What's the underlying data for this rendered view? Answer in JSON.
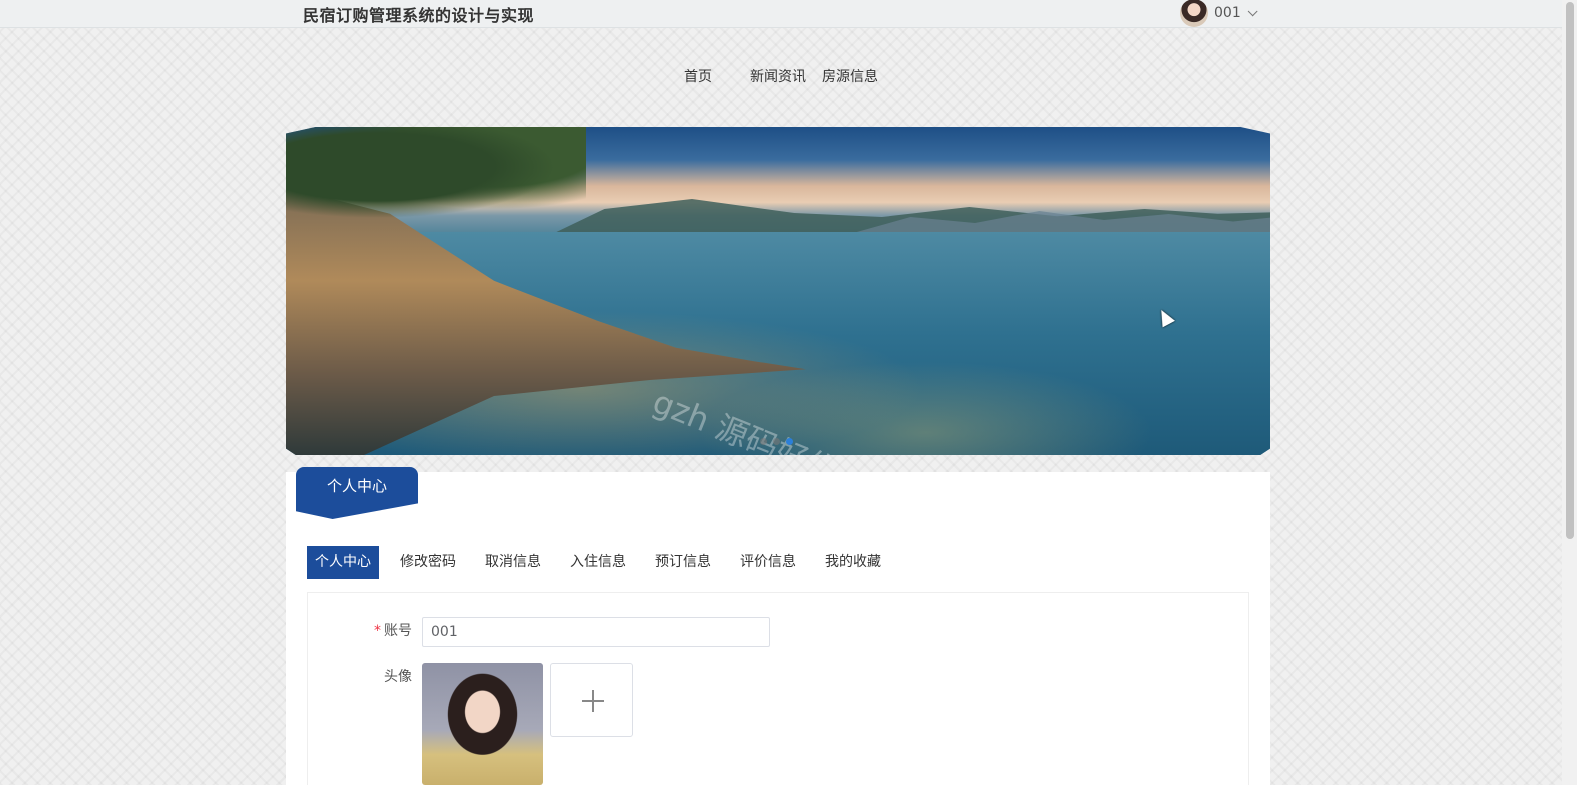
{
  "header": {
    "site_title": "民宿订购管理系统的设计与实现",
    "user_name": "001"
  },
  "nav": {
    "items": [
      "首页",
      "新闻资讯",
      "房源信息"
    ]
  },
  "banner": {
    "watermark": "gzh 源码好优多",
    "slides": 3,
    "active_slide": 3
  },
  "section": {
    "title": "个人中心"
  },
  "tabs": {
    "items": [
      "个人中心",
      "修改密码",
      "取消信息",
      "入住信息",
      "预订信息",
      "评价信息",
      "我的收藏"
    ],
    "active": "个人中心"
  },
  "form": {
    "account_label": "账号",
    "account_value": "001",
    "avatar_label": "头像"
  },
  "colors": {
    "primary": "#1c4d9b",
    "active_dot": "#2b7fd9",
    "required": "#ee3344"
  }
}
